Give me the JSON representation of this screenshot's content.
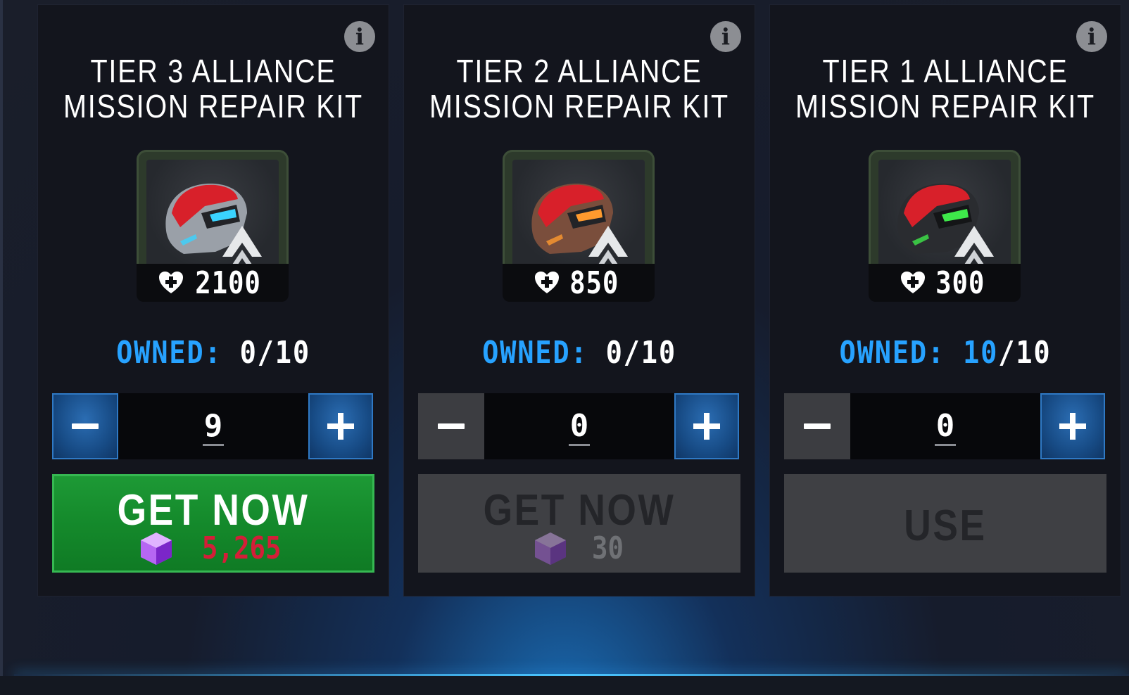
{
  "cards": [
    {
      "title_line1": "TIER 3 ALLIANCE",
      "title_line2": "MISSION REPAIR KIT",
      "heal_amount": "2100",
      "helmet_color": "#3ad3ff",
      "owned_label": "OWNED:",
      "owned_count": "0",
      "owned_max": "/10",
      "quantity": "9",
      "action_label": "GET NOW",
      "cost": "5,265"
    },
    {
      "title_line1": "TIER 2 ALLIANCE",
      "title_line2": "MISSION REPAIR KIT",
      "heal_amount": "850",
      "helmet_color": "#ff9a2e",
      "owned_label": "OWNED:",
      "owned_count": "0",
      "owned_max": "/10",
      "quantity": "0",
      "action_label": "GET NOW",
      "cost": "30"
    },
    {
      "title_line1": "TIER 1 ALLIANCE",
      "title_line2": "MISSION REPAIR KIT",
      "heal_amount": "300",
      "helmet_color": "#3ee84a",
      "owned_label": "OWNED:",
      "owned_count": "10",
      "owned_max": "/10",
      "quantity": "0",
      "action_label": "USE"
    }
  ],
  "icons": {
    "info": "i",
    "heal": "heart-plus-icon",
    "gem": "purple-gem-icon"
  },
  "colors": {
    "owned_label": "#27a2ff",
    "cost_red": "#d41e38",
    "button_green": "#158b2c",
    "button_blue": "#174b85"
  }
}
